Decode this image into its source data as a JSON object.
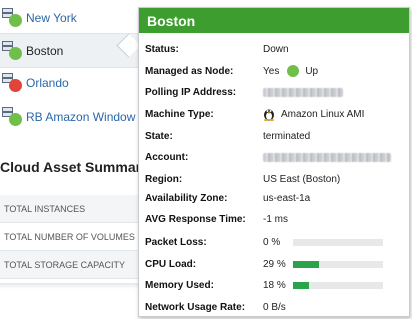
{
  "colors": {
    "status_up": "#6fbf4a",
    "status_down": "#e0443b",
    "header_green": "#3d9e2f",
    "bar_fill": "#2aa34a",
    "link_blue": "#2a67a8"
  },
  "nodes": [
    {
      "label": "New York",
      "status": "up",
      "icon": "server-icon"
    },
    {
      "label": "Boston",
      "status": "up",
      "icon": "server-icon"
    },
    {
      "label": "Orlando",
      "status": "down",
      "icon": "server-icon"
    },
    {
      "label": "RB Amazon Window",
      "status": "up",
      "icon": "server-icon"
    }
  ],
  "summary": {
    "title": "Cloud Asset Summary",
    "rows": [
      "TOTAL INSTANCES",
      "TOTAL NUMBER OF VOLUMES",
      "TOTAL STORAGE CAPACITY"
    ]
  },
  "popup": {
    "title": "Boston",
    "labels": {
      "status": "Status:",
      "managed": "Managed as Node:",
      "polling_ip": "Polling IP Address:",
      "machine_type": "Machine Type:",
      "state": "State:",
      "account": "Account:",
      "region": "Region:",
      "availability_zone": "Availability Zone:",
      "avg_response": "AVG Response Time:",
      "packet_loss": "Packet Loss:",
      "cpu_load": "CPU Load:",
      "memory_used": "Memory Used:",
      "network_usage": "Network Usage Rate:"
    },
    "values": {
      "status": "Down",
      "managed": "Yes",
      "managed_status": "Up",
      "machine_type": "Amazon Linux AMI",
      "machine_icon": "linux-penguin-icon",
      "state": "terminated",
      "region": "US East (Boston)",
      "availability_zone": "us-east-1a",
      "avg_response": "-1 ms",
      "packet_loss": "0 %",
      "packet_loss_fraction": 0,
      "cpu_load": "29 %",
      "cpu_load_fraction": 0.29,
      "memory_used": "18 %",
      "memory_used_fraction": 0.18,
      "network_usage": "0 B/s"
    }
  }
}
